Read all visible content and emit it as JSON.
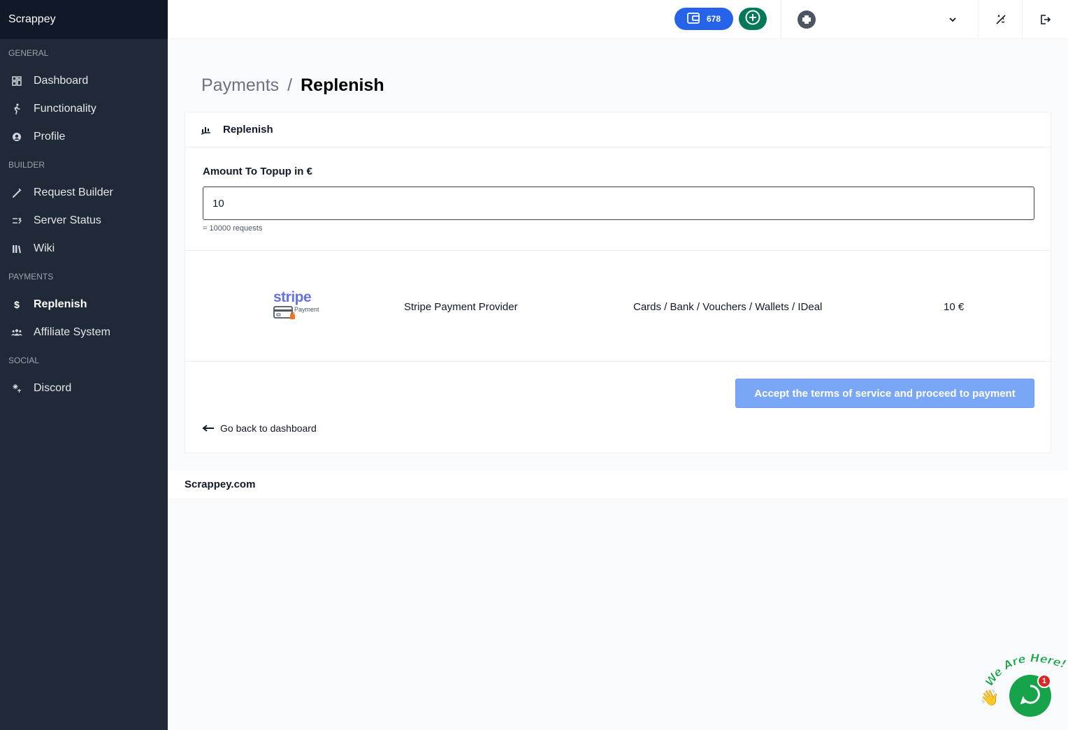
{
  "sidebar": {
    "brand": "Scrappey",
    "sections": [
      {
        "label": "GENERAL",
        "items": [
          {
            "label": "Dashboard",
            "icon": "dashboard-icon"
          },
          {
            "label": "Functionality",
            "icon": "walking-person-icon"
          },
          {
            "label": "Profile",
            "icon": "profile-icon"
          }
        ]
      },
      {
        "label": "BUILDER",
        "items": [
          {
            "label": "Request Builder",
            "icon": "wand-icon"
          },
          {
            "label": "Server Status",
            "icon": "status-icon"
          },
          {
            "label": "Wiki",
            "icon": "books-icon"
          }
        ]
      },
      {
        "label": "PAYMENTS",
        "items": [
          {
            "label": "Replenish",
            "icon": "dollar-icon",
            "active": true
          },
          {
            "label": "Affiliate System",
            "icon": "users-icon"
          }
        ]
      },
      {
        "label": "SOCIAL",
        "items": [
          {
            "label": "Discord",
            "icon": "discord-icon"
          }
        ]
      }
    ]
  },
  "topbar": {
    "balance": "678",
    "balance_color": "#2563eb",
    "add_color": "#047857"
  },
  "breadcrumb": {
    "parent": "Payments",
    "separator": "/",
    "current": "Replenish"
  },
  "card": {
    "title": "Replenish",
    "amount_label": "Amount To Topup in €",
    "amount_value": "10",
    "helper": "= 10000 requests",
    "provider": {
      "logo_text": "stripe",
      "logo_sub": "Payment",
      "name": "Stripe Payment Provider",
      "methods": "Cards / Bank / Vouchers / Wallets / IDeal",
      "amount": "10 €"
    },
    "pay_button": "Accept the terms of service and proceed to payment",
    "back_link": "Go back to dashboard"
  },
  "footer": {
    "text": "Scrappey.com"
  },
  "chat": {
    "tagline": "We Are Here!",
    "badge": "1"
  }
}
